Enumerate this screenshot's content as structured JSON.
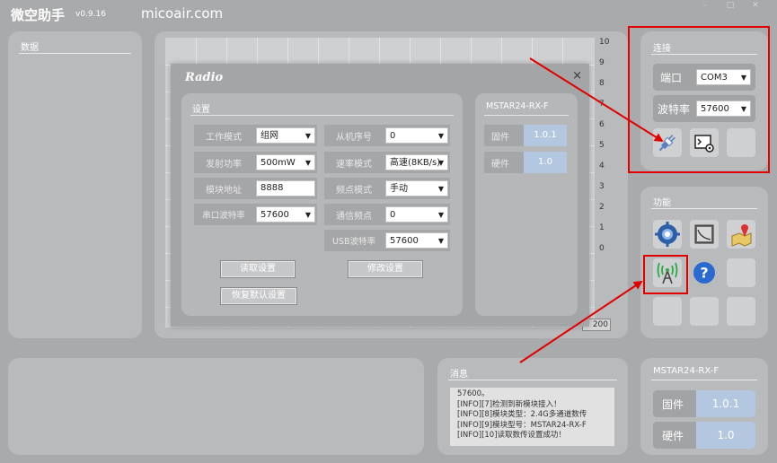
{
  "app": {
    "title": "微空助手",
    "version": "v0.9.16",
    "website": "micoair.com"
  },
  "data_panel": {
    "title": "数据"
  },
  "chart_axis": {
    "ticks": [
      "10",
      "9",
      "8",
      "7",
      "6",
      "5",
      "4",
      "3",
      "2",
      "1",
      "0"
    ],
    "bottom_label": "200"
  },
  "dialog": {
    "title": "Radio",
    "close": "×",
    "settings_title": "设置",
    "fields": [
      {
        "label": "工作模式",
        "value": "组网",
        "type": "select"
      },
      {
        "label": "发射功率",
        "value": "500mW",
        "type": "select"
      },
      {
        "label": "模块地址",
        "value": "8888",
        "type": "text"
      },
      {
        "label": "串口波特率",
        "value": "57600",
        "type": "select"
      },
      {
        "label": "从机序号",
        "value": "0",
        "type": "select"
      },
      {
        "label": "速率模式",
        "value": "高速(8KB/s)",
        "type": "select"
      },
      {
        "label": "频点模式",
        "value": "手动",
        "type": "select"
      },
      {
        "label": "通信频点",
        "value": "0",
        "type": "select"
      },
      {
        "label": "USB波特率",
        "value": "57600",
        "type": "select"
      }
    ],
    "read_button": "读取设置",
    "modify_button": "修改设置",
    "restore_button": "恢复默认设置",
    "device_title": "MSTAR24-RX-F",
    "firmware_label": "固件",
    "firmware_value": "1.0.1",
    "hardware_label": "硬件",
    "hardware_value": "1.0"
  },
  "connection": {
    "title": "连接",
    "port_label": "端口",
    "port_value": "COM3",
    "baud_label": "波特率",
    "baud_value": "57600"
  },
  "functions": {
    "title": "功能"
  },
  "messages": {
    "title": "消息",
    "lines": [
      "57600。",
      "[INFO][7]检测到新模块接入！",
      "[INFO][8]模块类型：2.4G多通道数传",
      "[INFO][9]模块型号：MSTAR24-RX-F",
      "[INFO][10]读取数传设置成功！"
    ]
  },
  "device_info": {
    "title": "MSTAR24-RX-F",
    "firmware_label": "固件",
    "firmware_value": "1.0.1",
    "hardware_label": "硬件",
    "hardware_value": "1.0"
  },
  "colors": {
    "annotation_red": "#e00000",
    "version_badge": "#b3c7e0",
    "background": "#a9aaac"
  }
}
